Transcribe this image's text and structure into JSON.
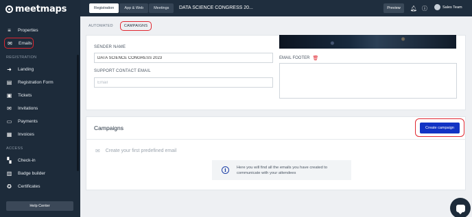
{
  "app": {
    "logo_text": "meetmaps"
  },
  "sidebar": {
    "items_top": [
      {
        "label": "Properties",
        "icon": "list-icon"
      },
      {
        "label": "Emails",
        "icon": "envelope-icon",
        "active": true
      }
    ],
    "section_registration": "REGISTRATION",
    "items_registration": [
      {
        "label": "Landing",
        "icon": "arrow-icon"
      },
      {
        "label": "Registration Form",
        "icon": "form-icon"
      },
      {
        "label": "Tickets",
        "icon": "ticket-icon"
      },
      {
        "label": "Invitations",
        "icon": "invitation-icon"
      },
      {
        "label": "Payments",
        "icon": "payments-icon"
      },
      {
        "label": "Invoices",
        "icon": "invoice-icon"
      }
    ],
    "section_access": "ACCESS",
    "items_access": [
      {
        "label": "Check-in",
        "icon": "grid-icon"
      },
      {
        "label": "Badge builder",
        "icon": "badge-icon"
      },
      {
        "label": "Certificates",
        "icon": "certificate-icon"
      }
    ],
    "help_center": "Help Center"
  },
  "topbar": {
    "tabs": [
      "Registration",
      "App & Web",
      "Meetings"
    ],
    "event_title": "DATA SCIENCE CONGRESS 20...",
    "preview": "Preview",
    "user_name": "Sales Team"
  },
  "subtabs": [
    "AUTOMATED",
    "CAMPAIGNS"
  ],
  "settings": {
    "sender_name_label": "SENDER NAME",
    "sender_name_value": "DATA SCIENCE CONGRESS 2023",
    "support_email_label": "SUPPORT CONTACT EMAIL",
    "support_email_placeholder": "Email",
    "email_footer_label": "EMAIL FOOTER"
  },
  "campaigns": {
    "title": "Campaigns",
    "create_button": "Create campaign",
    "empty_text": "Create your first predefined email",
    "info_text": "Here you will find all the emails you have created to communicate with your attendees"
  },
  "colors": {
    "sidebar_bg": "#1d2b3a",
    "accent_blue": "#1133c4",
    "highlight_red": "#e0262f"
  }
}
